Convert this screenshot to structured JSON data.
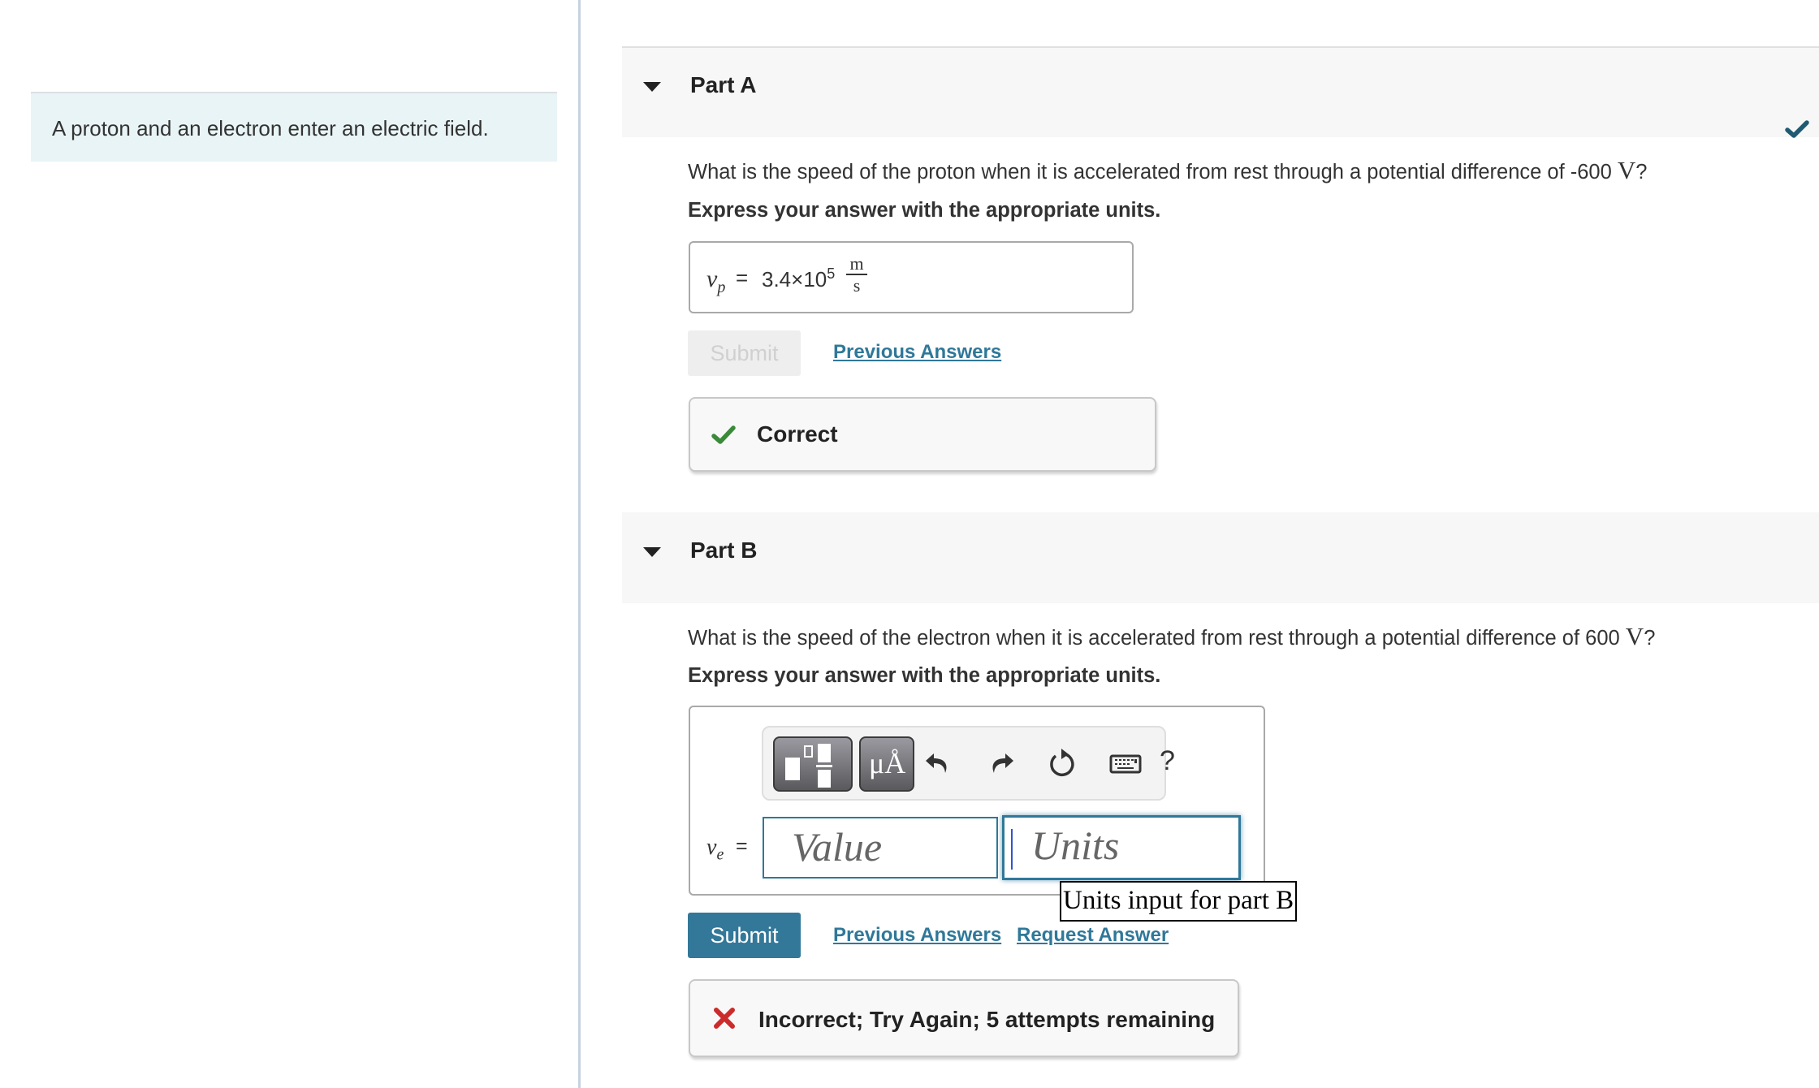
{
  "intro": {
    "text": "A proton and an electron enter an electric field."
  },
  "part_a": {
    "title": "Part A",
    "status": "completed",
    "question_prefix": "What is the speed of the proton when it is accelerated from rest through a potential difference of -600 ",
    "question_unit": "V",
    "question_suffix": "?",
    "instruction": "Express your answer with the appropriate units.",
    "answer": {
      "variable": "v",
      "subscript": "p",
      "equals": "=",
      "mantissa": "3.4×10",
      "exponent": "5",
      "unit_numerator": "m",
      "unit_denominator": "s"
    },
    "submit_label": "Submit",
    "previous_answers_label": "Previous Answers",
    "feedback": {
      "text": "Correct",
      "color": "#3a8a3a"
    }
  },
  "part_b": {
    "title": "Part B",
    "question_prefix": "What is the speed of the electron when it is accelerated from rest through a potential difference of 600 ",
    "question_unit": "V",
    "question_suffix": "?",
    "instruction": "Express your answer with the appropriate units.",
    "toolbar": {
      "templates_icon": "fraction-template-icon",
      "units_label": "μÅ",
      "undo_icon": "undo-icon",
      "redo_icon": "redo-icon",
      "reset_icon": "reset-icon",
      "keyboard_icon": "keyboard-icon",
      "help_label": "?"
    },
    "answer": {
      "variable": "v",
      "subscript": "e",
      "equals": "=",
      "value_placeholder": "Value",
      "units_placeholder": "Units",
      "value": "",
      "units": ""
    },
    "tooltip": "Units input for part B",
    "submit_label": "Submit",
    "previous_answers_label": "Previous Answers",
    "request_answer_label": "Request Answer",
    "feedback": {
      "text": "Incorrect; Try Again; 5 attempts remaining",
      "color": "#cc2b2b"
    }
  },
  "colors": {
    "accent": "#337899",
    "link": "#2f7899",
    "completed_check": "#1f5a72",
    "intro_bg": "#e9f4f6",
    "header_bg": "#f7f7f7"
  }
}
